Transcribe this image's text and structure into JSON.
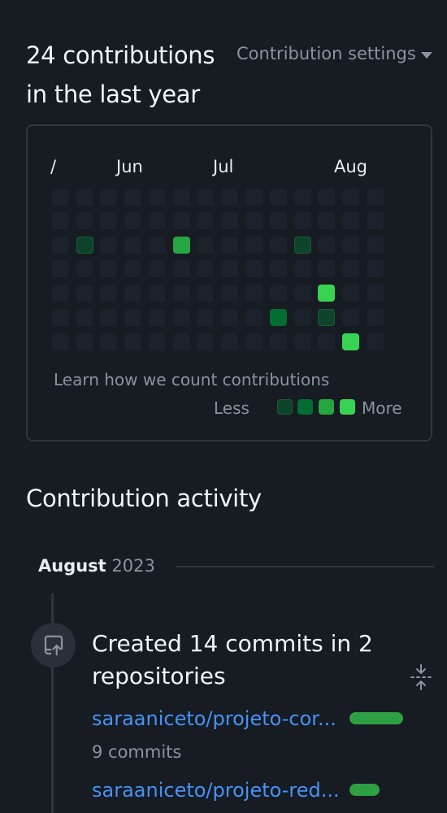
{
  "header": {
    "title": "24 contributions in the last year",
    "settings_label": "Contribution settings"
  },
  "calendar": {
    "months": [
      {
        "label": "/"
      },
      {
        "label": "Jun"
      },
      {
        "label": "Jul"
      },
      {
        "label": "Aug"
      }
    ],
    "learn_link": "Learn how we count contributions",
    "legend": {
      "less": "Less",
      "more": "More"
    },
    "colors": {
      "l0": "#1b222b",
      "l1": "#0e4429",
      "l2": "#006d32",
      "l3": "#26a641",
      "l4": "#39d353"
    }
  },
  "activity": {
    "title": "Contribution activity",
    "month": "August",
    "year": "2023",
    "event": {
      "title": "Created 14 commits in 2 repositories",
      "repos": [
        {
          "name": "saraaniceto/projeto-cor...",
          "commits": "9 commits"
        },
        {
          "name": "saraaniceto/projeto-red...",
          "commits": ""
        }
      ]
    }
  }
}
